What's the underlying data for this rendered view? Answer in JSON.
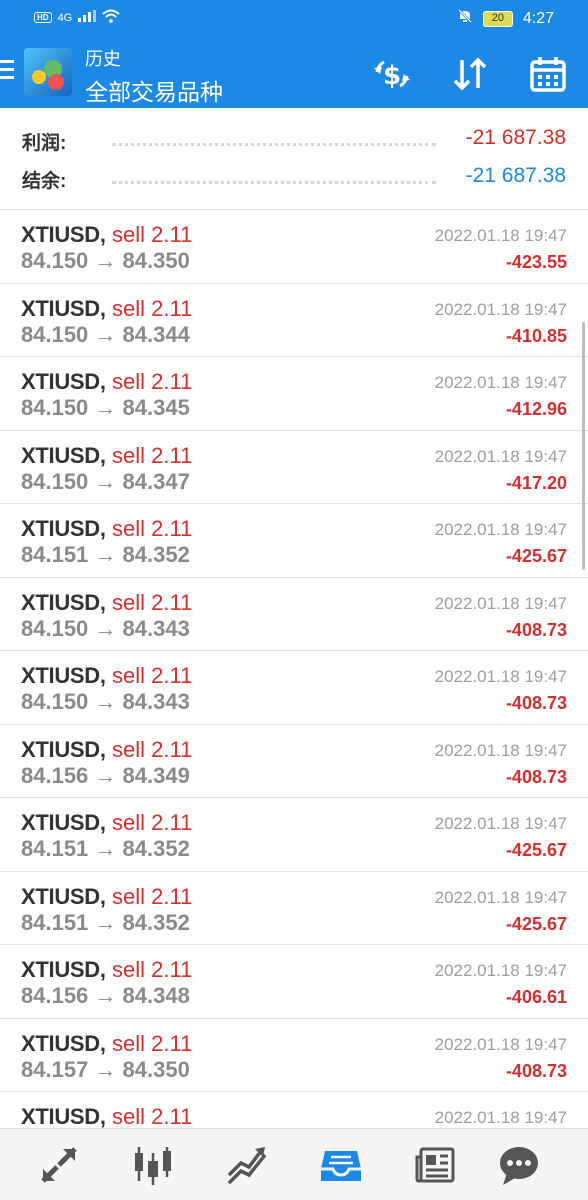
{
  "status_bar": {
    "network": "HD",
    "signal": "4G",
    "battery": "20",
    "time": "4:27"
  },
  "app_bar": {
    "title": "历史",
    "subtitle": "全部交易品种"
  },
  "summary": {
    "profit_label": "利润:",
    "profit_value": "-21 687.38",
    "balance_label": "结余:",
    "balance_value": "-21 687.38"
  },
  "trades": [
    {
      "symbol": "XTIUSD,",
      "side": "sell 2.11",
      "prices": "84.150 → 84.350",
      "time": "2022.01.18 19:47",
      "profit": "-423.55"
    },
    {
      "symbol": "XTIUSD,",
      "side": "sell 2.11",
      "prices": "84.150 → 84.344",
      "time": "2022.01.18 19:47",
      "profit": "-410.85"
    },
    {
      "symbol": "XTIUSD,",
      "side": "sell 2.11",
      "prices": "84.150 → 84.345",
      "time": "2022.01.18 19:47",
      "profit": "-412.96"
    },
    {
      "symbol": "XTIUSD,",
      "side": "sell 2.11",
      "prices": "84.150 → 84.347",
      "time": "2022.01.18 19:47",
      "profit": "-417.20"
    },
    {
      "symbol": "XTIUSD,",
      "side": "sell 2.11",
      "prices": "84.151 → 84.352",
      "time": "2022.01.18 19:47",
      "profit": "-425.67"
    },
    {
      "symbol": "XTIUSD,",
      "side": "sell 2.11",
      "prices": "84.150 → 84.343",
      "time": "2022.01.18 19:47",
      "profit": "-408.73"
    },
    {
      "symbol": "XTIUSD,",
      "side": "sell 2.11",
      "prices": "84.150 → 84.343",
      "time": "2022.01.18 19:47",
      "profit": "-408.73"
    },
    {
      "symbol": "XTIUSD,",
      "side": "sell 2.11",
      "prices": "84.156 → 84.349",
      "time": "2022.01.18 19:47",
      "profit": "-408.73"
    },
    {
      "symbol": "XTIUSD,",
      "side": "sell 2.11",
      "prices": "84.151 → 84.352",
      "time": "2022.01.18 19:47",
      "profit": "-425.67"
    },
    {
      "symbol": "XTIUSD,",
      "side": "sell 2.11",
      "prices": "84.151 → 84.352",
      "time": "2022.01.18 19:47",
      "profit": "-425.67"
    },
    {
      "symbol": "XTIUSD,",
      "side": "sell 2.11",
      "prices": "84.156 → 84.348",
      "time": "2022.01.18 19:47",
      "profit": "-406.61"
    },
    {
      "symbol": "XTIUSD,",
      "side": "sell 2.11",
      "prices": "84.157 → 84.350",
      "time": "2022.01.18 19:47",
      "profit": "-408.73"
    },
    {
      "symbol": "XTIUSD,",
      "side": "sell 2.11",
      "prices": "",
      "time": "2022.01.18 19:47",
      "profit": ""
    }
  ],
  "bottom_nav": [
    {
      "icon": "quotes-icon"
    },
    {
      "icon": "chart-candles-icon"
    },
    {
      "icon": "trade-icon"
    },
    {
      "icon": "history-inbox-icon",
      "active": true
    },
    {
      "icon": "news-icon"
    },
    {
      "icon": "chat-icon"
    }
  ],
  "colors": {
    "accent": "#1e88e5",
    "negative": "#d32f2f",
    "nav_active": "#1e88e5",
    "nav_inactive": "#555555"
  }
}
